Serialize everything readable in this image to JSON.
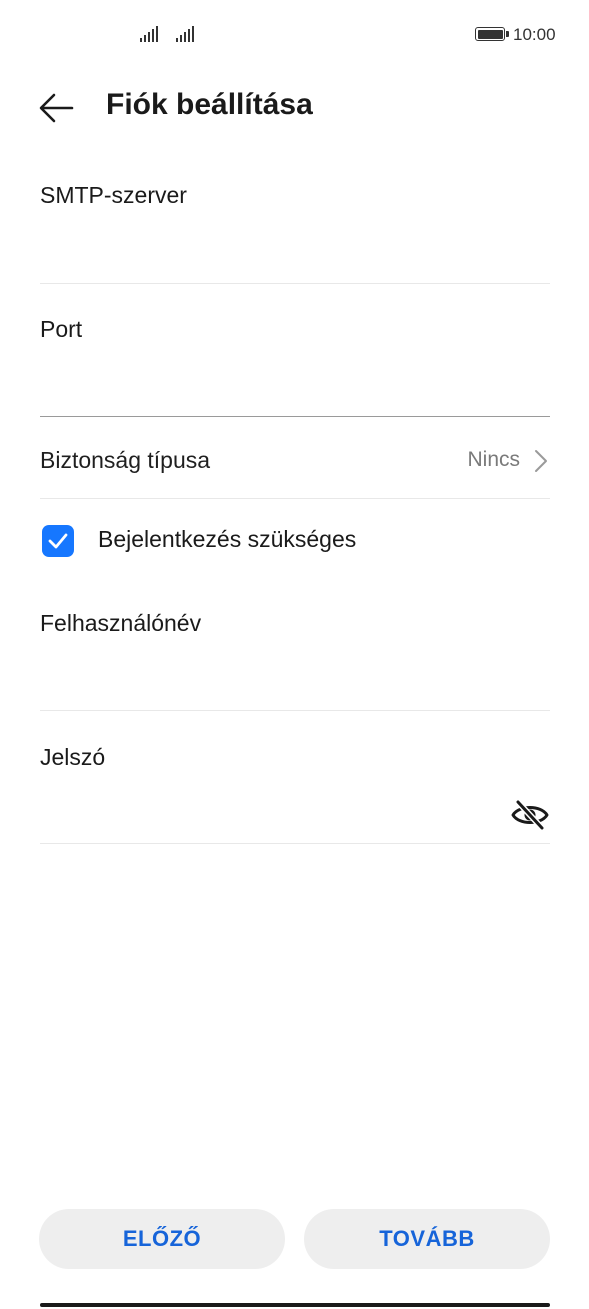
{
  "status_bar": {
    "time": "10:00"
  },
  "header": {
    "title": "Fiók beállítása"
  },
  "form": {
    "smtp_server": {
      "label": "SMTP-szerver",
      "value": ""
    },
    "port": {
      "label": "Port",
      "value": ""
    },
    "security": {
      "label": "Biztonság típusa",
      "value": "Nincs"
    },
    "login_required": {
      "label": "Bejelentkezés szükséges",
      "checked": true
    },
    "username": {
      "label": "Felhasználónév",
      "value": ""
    },
    "password": {
      "label": "Jelszó",
      "value": ""
    }
  },
  "footer": {
    "prev_label": "ELŐZŐ",
    "next_label": "TOVÁBB"
  },
  "colors": {
    "accent": "#1677ff",
    "button_text": "#1664d9",
    "button_bg": "#eeeeee"
  },
  "icons": {
    "back": "arrow-left-icon",
    "chevron": "chevron-right-icon",
    "eye": "eye-off-icon",
    "check": "check-icon"
  }
}
